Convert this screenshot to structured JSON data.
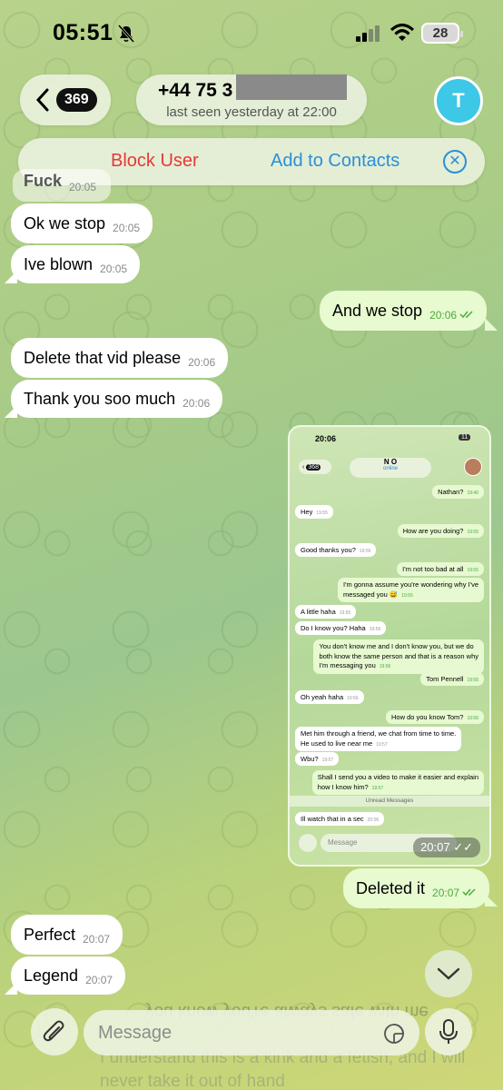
{
  "status_bar": {
    "time": "05:51",
    "battery": "28"
  },
  "header": {
    "back_badge": "369",
    "title": "+44 75 3",
    "subtitle": "last seen yesterday at 22:00",
    "avatar_letter": "T"
  },
  "actions": {
    "block": "Block User",
    "add": "Add to Contacts"
  },
  "messages": [
    {
      "text": "Fuck",
      "time": "20:05"
    },
    {
      "text": "Ok we stop",
      "time": "20:05"
    },
    {
      "text": "Ive blown",
      "time": "20:05"
    },
    {
      "text": "And we stop",
      "time": "20:06"
    },
    {
      "text": "Delete that vid please",
      "time": "20:06"
    },
    {
      "text": "Thank you soo much",
      "time": "20:06"
    },
    {
      "text": "Deleted it",
      "time": "20:07"
    },
    {
      "text": "Perfect",
      "time": "20:07"
    },
    {
      "text": "Legend",
      "time": "20:07"
    }
  ],
  "photo": {
    "overlay_time": "20:07",
    "status_time": "20:06",
    "status_battery": "11",
    "back_badge": "368",
    "contact_name": "N O",
    "contact_status": "online",
    "unread_label": "Unread Messages",
    "input_placeholder": "Message",
    "msgs": [
      {
        "text": "Nathan?",
        "time": "19:40"
      },
      {
        "text": "Hey",
        "time": "19:55"
      },
      {
        "text": "How are you doing?",
        "time": "19:55"
      },
      {
        "text": "Good thanks you?",
        "time": "19:55"
      },
      {
        "text": "I'm not too bad at all",
        "time": "19:55"
      },
      {
        "text": "I'm gonna assume you're wondering why I've",
        "text2": "messaged you 😅",
        "time": "19:55"
      },
      {
        "text": "A little haha",
        "time": "19:55"
      },
      {
        "text": "Do I know you? Haha",
        "time": "19:56"
      },
      {
        "text": "You don't know me and I don't know you, but we do",
        "text2": "both know the same person and that is a reason why",
        "text3": "I'm messaging you",
        "time": "19:56"
      },
      {
        "text": "Tom Pennell",
        "time": "19:56"
      },
      {
        "text": "Oh yeah haha",
        "time": "19:56"
      },
      {
        "text": "How do you know Tom?",
        "time": "19:56"
      },
      {
        "text": "Met him through a friend, we chat from time to time.",
        "text2": "He used to live near me",
        "time": "19:57"
      },
      {
        "text": "Wbu?",
        "time": "19:57"
      },
      {
        "text": "Shall I send you a video to make it easier and explain",
        "text2": "how I know him?",
        "time": "19:57"
      },
      {
        "text": "Ill watch that in a sec",
        "time": "20:06"
      }
    ]
  },
  "ghost": {
    "line1": "you know you're always safe with me",
    "line2": "I understand this is a kink and a fetish, and I will",
    "line3": "never take it out of hand"
  },
  "input": {
    "placeholder": "Message"
  },
  "colors": {
    "incoming": "#ffffff",
    "outgoing": "#e7fad0",
    "accent": "#2a8fd8",
    "danger": "#e53935",
    "avatar": "#3cc8e6"
  }
}
